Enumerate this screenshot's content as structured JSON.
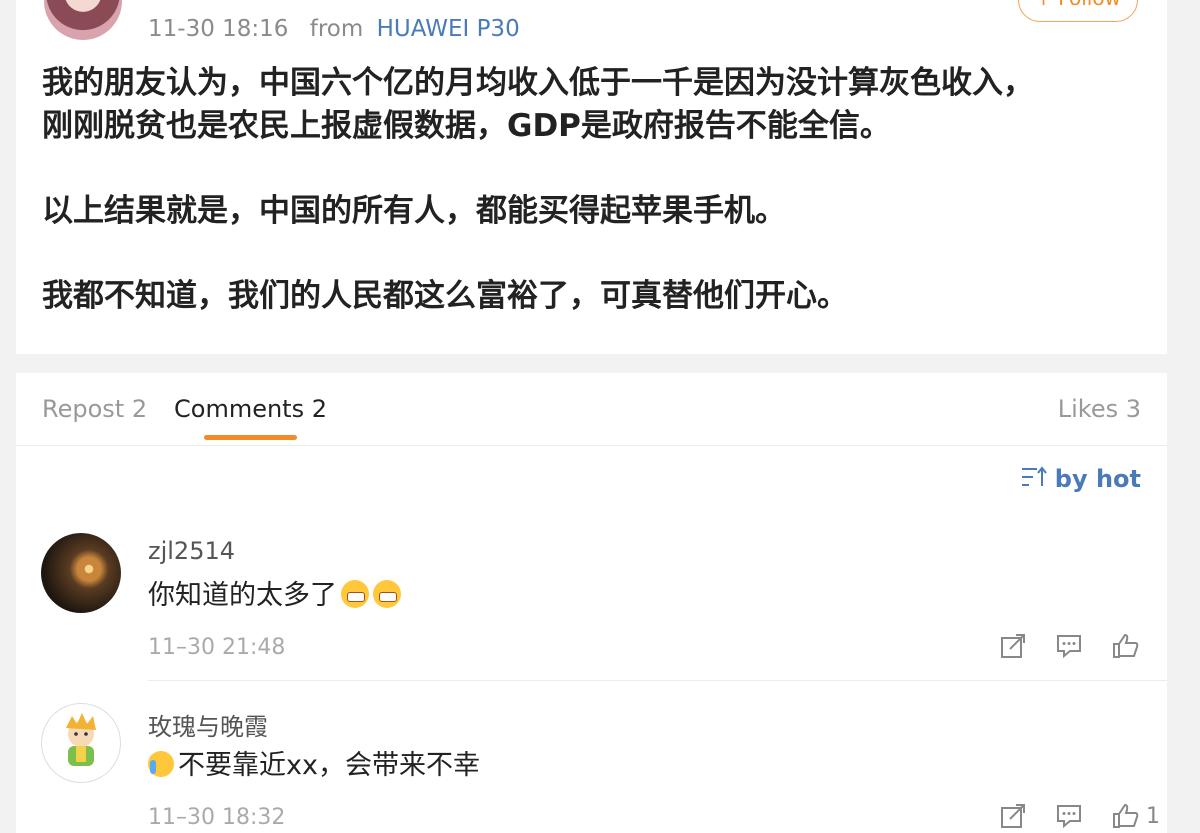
{
  "post": {
    "time": "11-30 18:16",
    "from_label": "from",
    "device": "HUAWEI P30",
    "follow_label": "+ Follow",
    "paragraphs": [
      "我的朋友认为，中国六个亿的月均收入低于一千是因为没计算灰色收入，",
      "刚刚脱贫也是农民上报虚假数据，GDP是政府报告不能全信。",
      "以上结果就是，中国的所有人，都能买得起苹果手机。",
      "我都不知道，我们的人民都这么富裕了，可真替他们开心。"
    ]
  },
  "tabs": {
    "repost": "Repost 2",
    "comments": "Comments 2",
    "likes": "Likes 3"
  },
  "sort": {
    "label": "by hot"
  },
  "comments": [
    {
      "user": "zjl2514",
      "text": "你知道的太多了",
      "time": "11–30 21:48",
      "likes": ""
    },
    {
      "user": "玫瑰与晚霞",
      "text": "不要靠近xx，会带来不幸",
      "time": "11–30 18:32",
      "likes": "1"
    }
  ],
  "colors": {
    "accent": "#f28c28",
    "link": "#4a7ab8"
  }
}
